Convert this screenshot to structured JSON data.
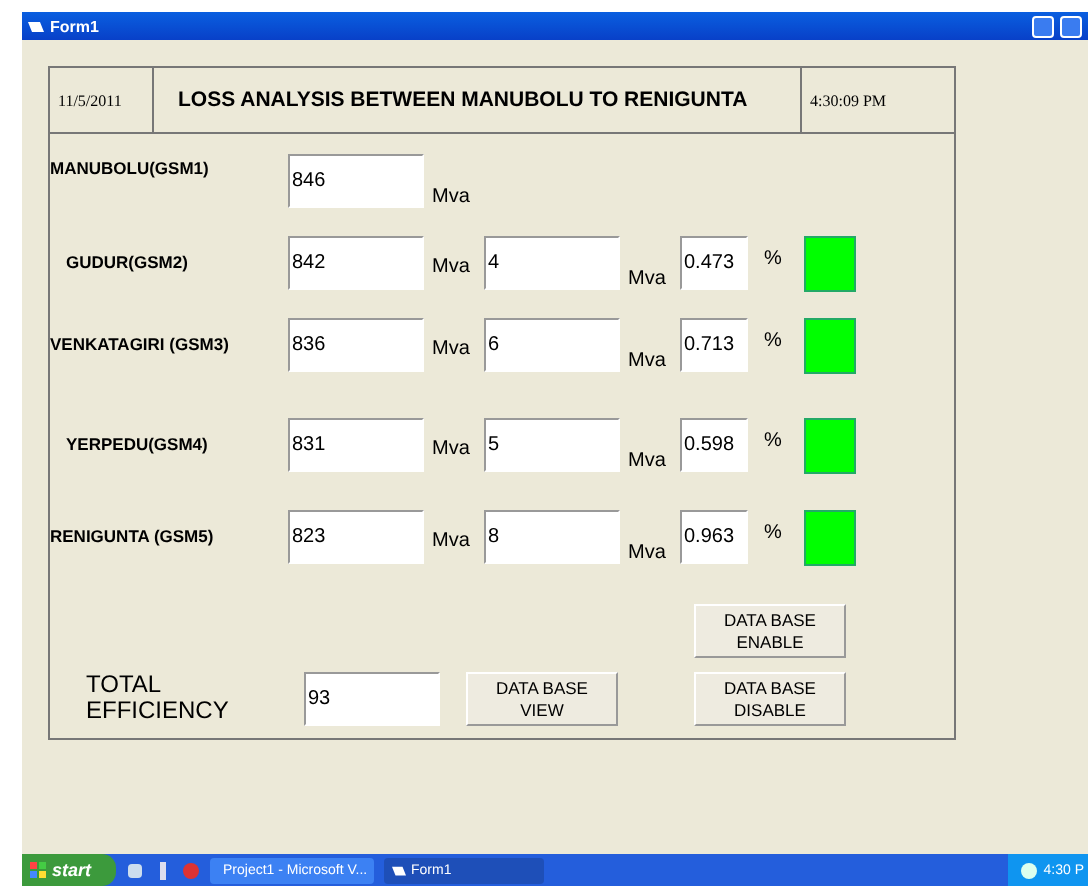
{
  "window": {
    "title": "Form1"
  },
  "header": {
    "date": "11/5/2011",
    "title": "LOSS ANALYSIS BETWEEN MANUBOLU TO RENIGUNTA",
    "time": "4:30:09 PM"
  },
  "stations": [
    {
      "label": "MANUBOLU(GSM1)",
      "value": "846",
      "unit": "Mva"
    },
    {
      "label": "GUDUR(GSM2)",
      "value": "842",
      "unit": "Mva",
      "loss": "4",
      "loss_unit": "Mva",
      "percent": "0.473",
      "percent_sign": "%",
      "color": "#00ff00"
    },
    {
      "label": "VENKATAGIRI (GSM3)",
      "value": "836",
      "unit": "Mva",
      "loss": "6",
      "loss_unit": "Mva",
      "percent": "0.713",
      "percent_sign": "%",
      "color": "#00ff00"
    },
    {
      "label": "YERPEDU(GSM4)",
      "value": "831",
      "unit": "Mva",
      "loss": "5",
      "loss_unit": "Mva",
      "percent": "0.598",
      "percent_sign": "%",
      "color": "#00ff00"
    },
    {
      "label": "RENIGUNTA (GSM5)",
      "value": "823",
      "unit": "Mva",
      "loss": "8",
      "loss_unit": "Mva",
      "percent": "0.963",
      "percent_sign": "%",
      "color": "#00ff00"
    }
  ],
  "total": {
    "label": "TOTAL EFFICIENCY",
    "value": "93"
  },
  "buttons": {
    "view": "DATA BASE VIEW",
    "enable": "DATA BASE ENABLE",
    "disable": "DATA BASE DISABLE"
  },
  "taskbar": {
    "start": "start",
    "tasks": [
      {
        "label": "Project1 - Microsoft V...",
        "selected": false
      },
      {
        "label": "Form1",
        "selected": true
      }
    ],
    "clock": "4:30 P"
  }
}
